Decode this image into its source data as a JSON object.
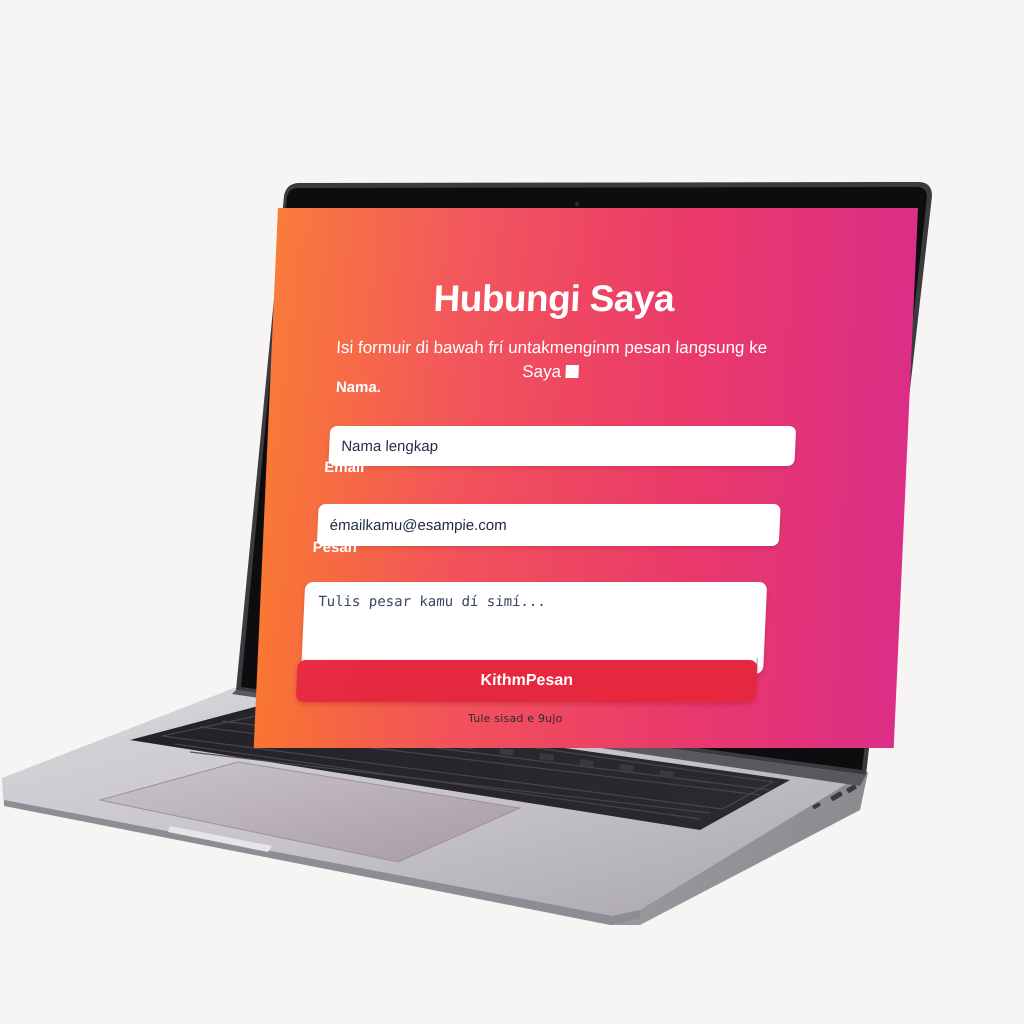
{
  "page": {
    "title": "Hubungi Saya",
    "subtitle": "Isi formuir di bawah frí untakmenginm pesan langsung ke Saya"
  },
  "form": {
    "name_label": "Nama.",
    "name_placeholder": "Nama lengkap",
    "email_label": "Email",
    "email_placeholder": "émailkamu@esampie.com",
    "message_label": "Pesan",
    "message_placeholder": "Tulis pesar kamu dí simí...",
    "submit_label": "KithmPesan"
  },
  "device": {
    "hinge_label": "Tule sisad e 9ujo"
  },
  "colors": {
    "gradient_start": "#f9732f",
    "gradient_end": "#dc2e86",
    "button": "#e6283f"
  }
}
